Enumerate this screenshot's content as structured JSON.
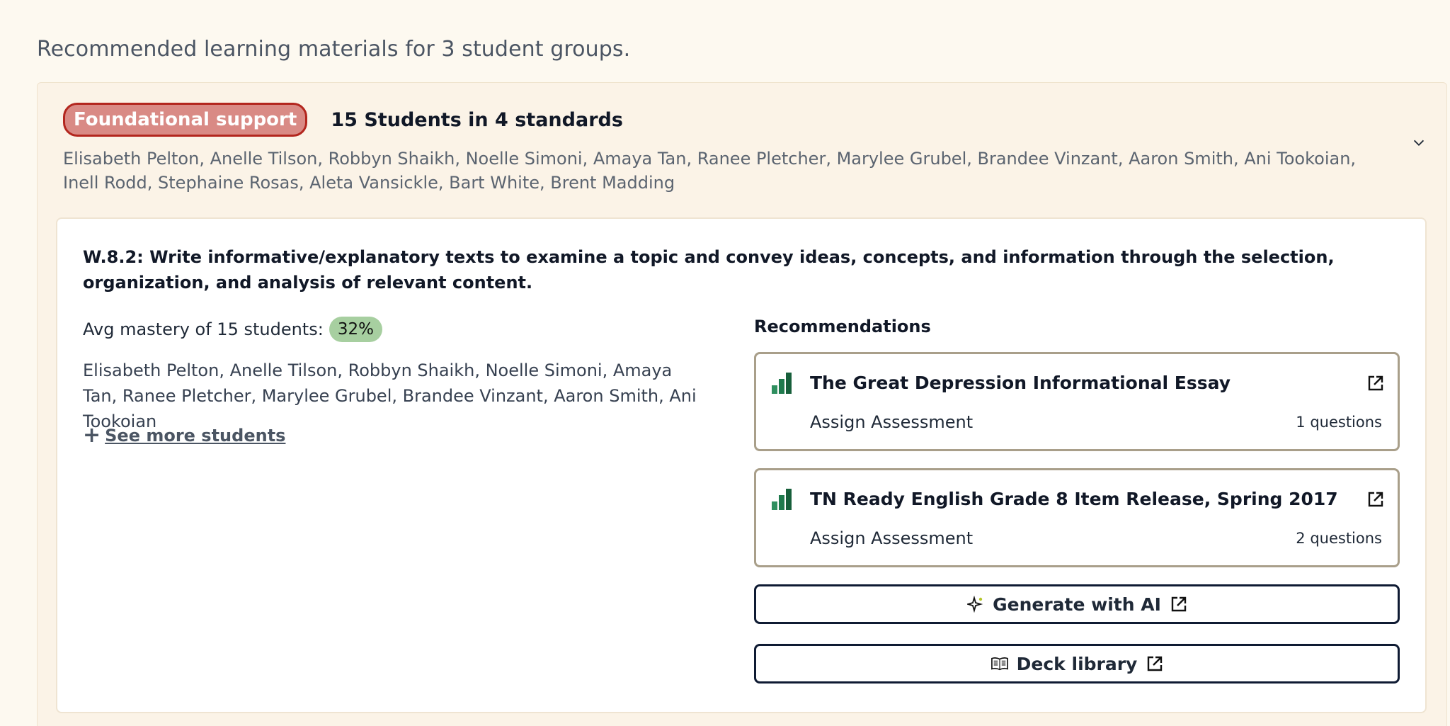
{
  "intro": "Recommended learning materials for 3 student groups.",
  "group": {
    "badge": "Foundational support",
    "title": "15 Students in 4 standards",
    "students": "Elisabeth Pelton, Anelle Tilson, Robbyn Shaikh, Noelle Simoni, Amaya Tan, Ranee Pletcher, Marylee Grubel, Brandee Vinzant, Aaron Smith, Ani Tookoian, Inell Rodd, Stephaine Rosas, Aleta Vansickle, Bart White, Brent Madding",
    "badge_color": "#d98a85",
    "badge_border": "#b3261e"
  },
  "standard": {
    "title": "W.8.2: Write informative/explanatory texts to examine a topic and convey ideas, concepts, and information through the selection, organization, and analysis of relevant content.",
    "mastery_label": "Avg mastery of 15 students:",
    "mastery_value": "32%",
    "students": "Elisabeth Pelton, Anelle Tilson, Robbyn Shaikh, Noelle Simoni, Amaya Tan, Ranee Pletcher, Marylee Grubel, Brandee Vinzant, Aaron Smith, Ani Tookoian",
    "see_more": "See more students"
  },
  "recommendations": {
    "label": "Recommendations",
    "items": [
      {
        "title": "The Great Depression Informational Essay",
        "action": "Assign Assessment",
        "count": "1 questions"
      },
      {
        "title": "TN Ready English Grade 8 Item Release, Spring 2017",
        "action": "Assign Assessment",
        "count": "2 questions"
      }
    ],
    "generate_label": "Generate with AI",
    "deck_label": "Deck library"
  },
  "icons": {
    "rec_icon": "bar-steps-icon",
    "external": "external-link-icon",
    "ai": "sparkle-icon",
    "deck": "open-book-icon",
    "chevron": "chevron-down-icon"
  }
}
